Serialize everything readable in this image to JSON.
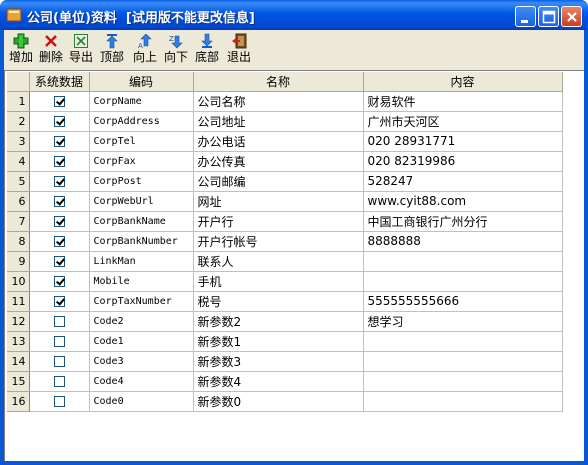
{
  "window": {
    "title": "公司(单位)资料  [试用版不能更改信息]"
  },
  "toolbar": {
    "items": [
      {
        "label": "增加",
        "icon": "add-icon"
      },
      {
        "label": "删除",
        "icon": "delete-icon"
      },
      {
        "label": "导出",
        "icon": "export-icon"
      },
      {
        "label": "顶部",
        "icon": "move-top-icon"
      },
      {
        "label": "向上",
        "icon": "move-up-icon"
      },
      {
        "label": "向下",
        "icon": "move-down-icon"
      },
      {
        "label": "底部",
        "icon": "move-bottom-icon"
      },
      {
        "label": "退出",
        "icon": "exit-icon"
      }
    ]
  },
  "grid": {
    "columns": [
      "系统数据",
      "编码",
      "名称",
      "内容"
    ],
    "rows": [
      {
        "no": "1",
        "system": true,
        "code": "CorpName",
        "name": "公司名称",
        "content": "财易软件"
      },
      {
        "no": "2",
        "system": true,
        "code": "CorpAddress",
        "name": "公司地址",
        "content": "广州市天河区"
      },
      {
        "no": "3",
        "system": true,
        "code": "CorpTel",
        "name": "办公电话",
        "content": "020 28931771"
      },
      {
        "no": "4",
        "system": true,
        "code": "CorpFax",
        "name": "办公传真",
        "content": "020 82319986"
      },
      {
        "no": "5",
        "system": true,
        "code": "CorpPost",
        "name": "公司邮编",
        "content": "528247"
      },
      {
        "no": "6",
        "system": true,
        "code": "CorpWebUrl",
        "name": "网址",
        "content": "www.cyit88.com"
      },
      {
        "no": "7",
        "system": true,
        "code": "CorpBankName",
        "name": "开户行",
        "content": "中国工商银行广州分行"
      },
      {
        "no": "8",
        "system": true,
        "code": "CorpBankNumber",
        "name": "开户行帐号",
        "content": "8888888"
      },
      {
        "no": "9",
        "system": true,
        "code": "LinkMan",
        "name": "联系人",
        "content": ""
      },
      {
        "no": "10",
        "system": true,
        "code": "Mobile",
        "name": "手机",
        "content": ""
      },
      {
        "no": "11",
        "system": true,
        "code": "CorpTaxNumber",
        "name": "税号",
        "content": "555555555666"
      },
      {
        "no": "12",
        "system": false,
        "code": "Code2",
        "name": "新参数2",
        "content": "想学习"
      },
      {
        "no": "13",
        "system": false,
        "code": "Code1",
        "name": "新参数1",
        "content": ""
      },
      {
        "no": "14",
        "system": false,
        "code": "Code3",
        "name": "新参数3",
        "content": ""
      },
      {
        "no": "15",
        "system": false,
        "code": "Code4",
        "name": "新参数4",
        "content": ""
      },
      {
        "no": "16",
        "system": false,
        "code": "Code0",
        "name": "新参数0",
        "content": ""
      }
    ]
  }
}
